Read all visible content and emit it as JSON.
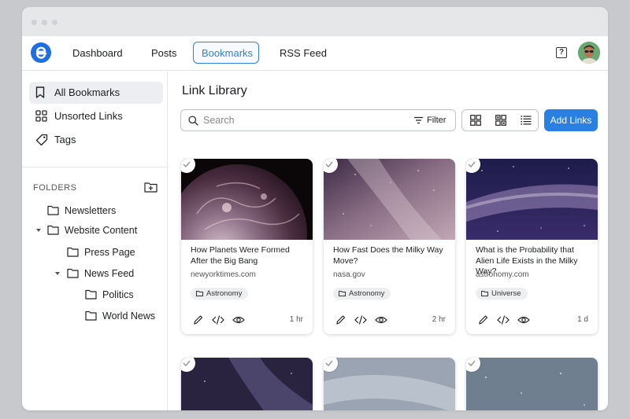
{
  "nav": {
    "logo_letter": "e",
    "dashboard": "Dashboard",
    "posts": "Posts",
    "bookmarks": "Bookmarks",
    "rss_feed": "RSS Feed",
    "help_label": "?"
  },
  "sidebar": {
    "all_bookmarks": "All Bookmarks",
    "unsorted_links": "Unsorted Links",
    "tags": "Tags",
    "folders_label": "FOLDERS",
    "tree": {
      "newsletters": "Newsletters",
      "website_content": "Website Content",
      "press_page": "Press Page",
      "news_feed": "News Feed",
      "politics": "Politics",
      "world_news": "World News"
    }
  },
  "main": {
    "title": "Link Library",
    "search_placeholder": "Search",
    "filter_label": "Filter",
    "add_links": "Add Links"
  },
  "cards": [
    {
      "title": "How Planets Were Formed After the Big Bang",
      "domain": "newyorktimes.com",
      "tag": "Astronomy",
      "time": "1 hr"
    },
    {
      "title": "How Fast Does the Milky Way Move?",
      "domain": "nasa.gov",
      "tag": "Astronomy",
      "time": "2 hr"
    },
    {
      "title": "What is the Probability that Alien Life Exists in the Milky Way?",
      "domain": "astronomy.com",
      "tag": "Universe",
      "time": "1 d"
    }
  ],
  "colors": {
    "accent": "#2a7fe3",
    "active_nav": "#2f80d8"
  }
}
